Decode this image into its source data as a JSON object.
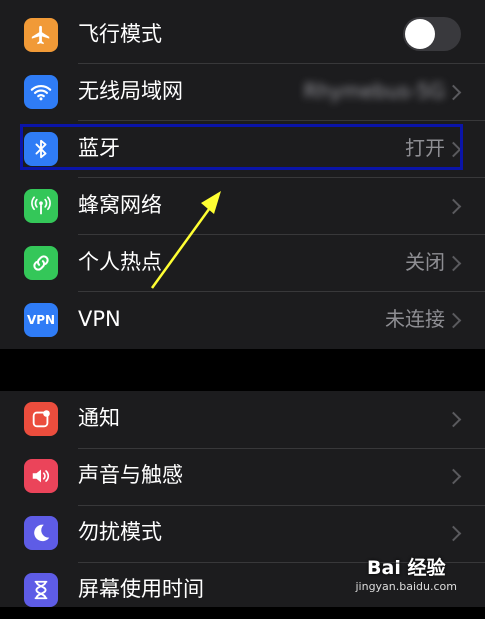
{
  "section1": {
    "items": [
      {
        "label": "飞行模式",
        "value": "",
        "icon": "airplane-icon",
        "color": "#f19a37"
      },
      {
        "label": "无线局域网",
        "value": "Rhymebus-5G",
        "icon": "wifi-icon",
        "color": "#2f7cf6"
      },
      {
        "label": "蓝牙",
        "value": "打开",
        "icon": "bluetooth-icon",
        "color": "#2f7cf6"
      },
      {
        "label": "蜂窝网络",
        "value": "",
        "icon": "cellular-icon",
        "color": "#34c759"
      },
      {
        "label": "个人热点",
        "value": "关闭",
        "icon": "hotspot-icon",
        "color": "#34c759"
      },
      {
        "label": "VPN",
        "value": "未连接",
        "icon": "vpn-icon",
        "icon_text": "VPN",
        "color": "#2f7cf6"
      }
    ]
  },
  "section2": {
    "items": [
      {
        "label": "通知",
        "icon": "notification-icon",
        "color": "#eb4d3d"
      },
      {
        "label": "声音与触感",
        "icon": "speaker-icon",
        "color": "#eb445a"
      },
      {
        "label": "勿扰模式",
        "icon": "moon-icon",
        "color": "#5e5ce6"
      },
      {
        "label": "屏幕使用时间",
        "icon": "hourglass-icon",
        "color": "#5e5ce6"
      }
    ]
  },
  "annotation": {
    "highlight_color": "#0a14a8",
    "arrow_color": "#ffff33"
  },
  "watermark": {
    "main": "Bai 经验",
    "sub": "jingyan.baidu.com"
  }
}
